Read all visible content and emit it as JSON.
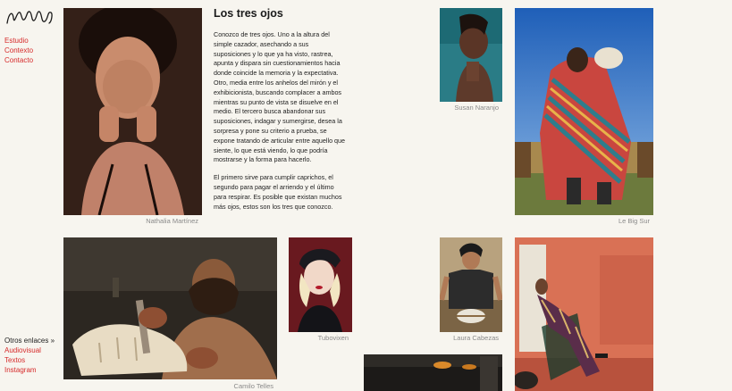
{
  "nav": {
    "items": [
      "Estudio",
      "Contexto",
      "Contacto"
    ]
  },
  "links": {
    "header": "Otros enlaces »",
    "items": [
      "Audiovisual",
      "Textos",
      "Instagram"
    ]
  },
  "article": {
    "title": "Los tres ojos",
    "paragraphs": [
      "Conozco de tres ojos. Uno a la altura del simple cazador, asechando a sus suposiciones y lo que ya ha visto, rastrea, apunta y dispara sin cuestionamientos hacia donde coincide la memoria y la expectativa. Otro, media entre los anhelos del mirón y el exhibicionista, buscando complacer a ambos mientras su punto de vista se disuelve en el medio. El tercero busca abandonar sus suposiciones, indagar y sumergirse, desea la sorpresa y pone su criterio a prueba, se expone tratando de articular entre aquello que siente, lo que está viendo, lo que podría mostrarse y la forma para hacerlo.",
      "El primero sirve para cumplir caprichos, el segundo para pagar el arriendo y el último para respirar. Es posible que existan muchos más ojos, estos son los tres que conozco."
    ]
  },
  "photos": {
    "nathalia": "Nathalia Martínez",
    "susan": "Susan Naranjo",
    "lebigsur": "Le Big Sur",
    "camilo": "Camilo Telles",
    "tubovixen": "Tubovixen",
    "laura": "Laura Cabezas"
  },
  "colors": {
    "link": "#d62b2b",
    "background": "#f7f5ef",
    "caption": "#8a8a8a"
  }
}
